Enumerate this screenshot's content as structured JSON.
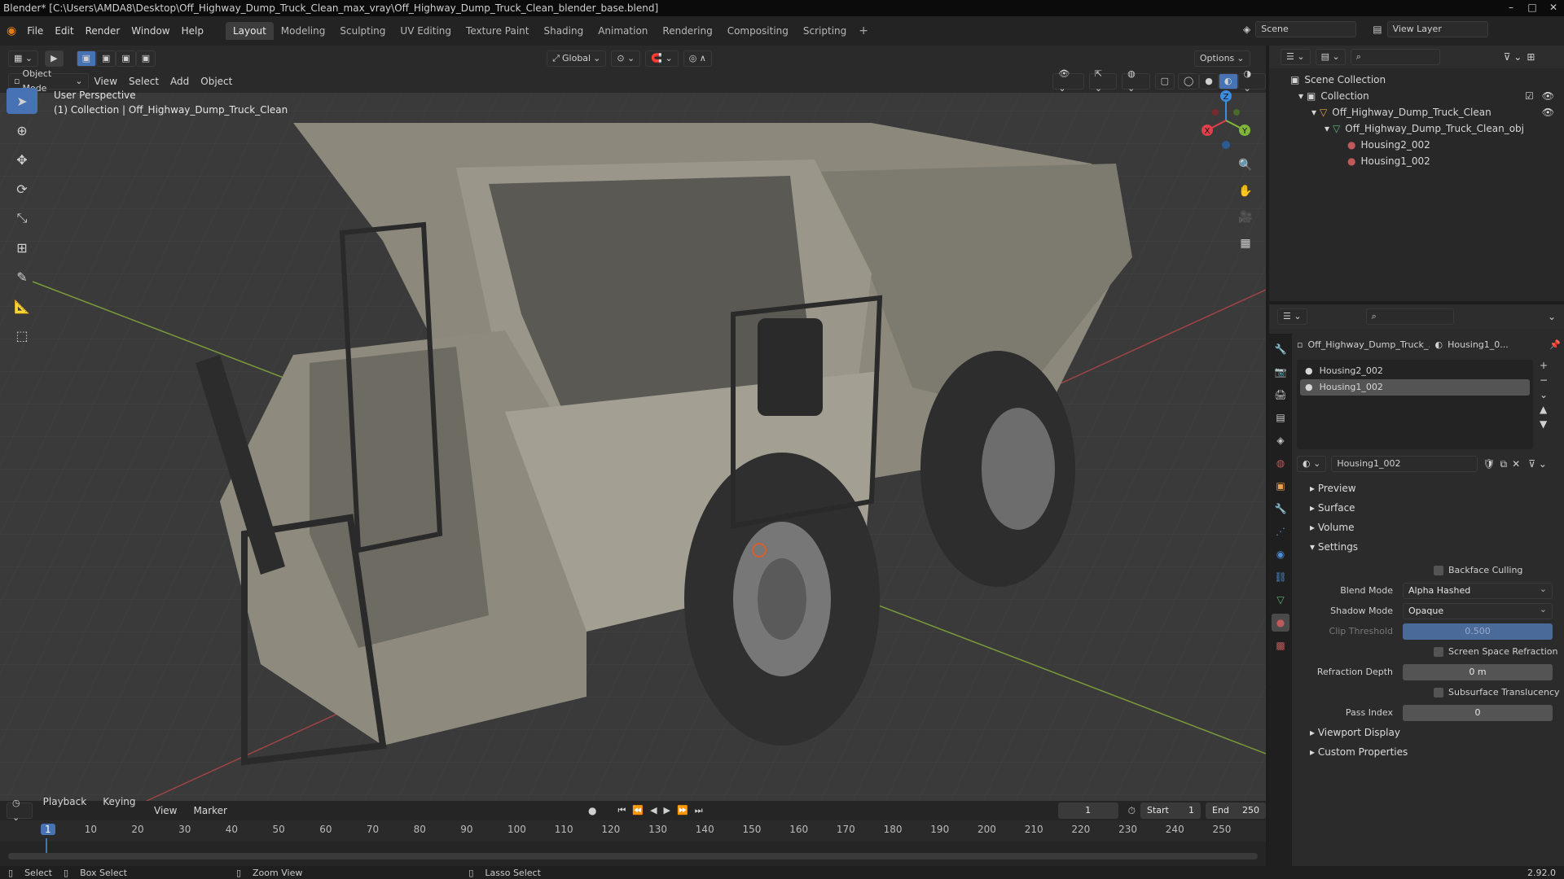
{
  "window": {
    "title": "Blender* [C:\\Users\\AMDA8\\Desktop\\Off_Highway_Dump_Truck_Clean_max_vray\\Off_Highway_Dump_Truck_Clean_blender_base.blend]"
  },
  "menu": [
    "File",
    "Edit",
    "Render",
    "Window",
    "Help"
  ],
  "workspaces": [
    "Layout",
    "Modeling",
    "Sculpting",
    "UV Editing",
    "Texture Paint",
    "Shading",
    "Animation",
    "Rendering",
    "Compositing",
    "Scripting"
  ],
  "active_workspace": "Layout",
  "scene": {
    "label": "Scene",
    "view_layer": "View Layer"
  },
  "viewport": {
    "transform_orientation": "Global",
    "options_label": "Options",
    "mode": "Object Mode",
    "menus": [
      "View",
      "Select",
      "Add",
      "Object"
    ],
    "info_line1": "User Perspective",
    "info_line2": "(1) Collection | Off_Highway_Dump_Truck_Clean",
    "gizmo_axes": {
      "x": "X",
      "y": "Y",
      "z": "Z"
    }
  },
  "outliner": {
    "items": [
      {
        "label": "Scene Collection",
        "level": 0
      },
      {
        "label": "Collection",
        "level": 1
      },
      {
        "label": "Off_Highway_Dump_Truck_Clean",
        "level": 2
      },
      {
        "label": "Off_Highway_Dump_Truck_Clean_obj",
        "level": 3
      },
      {
        "label": "Housing2_002",
        "level": 4
      },
      {
        "label": "Housing1_002",
        "level": 4
      }
    ]
  },
  "properties": {
    "object_name": "Off_Highway_Dump_Truck_...",
    "material_name_short": "Housing1_0...",
    "slots": [
      "Housing2_002",
      "Housing1_002"
    ],
    "selected_slot": "Housing1_002",
    "material": "Housing1_002",
    "panels": {
      "preview": "Preview",
      "surface": "Surface",
      "volume": "Volume",
      "settings": "Settings",
      "viewport_display": "Viewport Display",
      "custom_properties": "Custom Properties"
    },
    "settings": {
      "backface_culling": "Backface Culling",
      "blend_mode_label": "Blend Mode",
      "blend_mode": "Alpha Hashed",
      "shadow_mode_label": "Shadow Mode",
      "shadow_mode": "Opaque",
      "clip_threshold_label": "Clip Threshold",
      "clip_threshold": "0.500",
      "ssr_label": "Screen Space Refraction",
      "refraction_depth_label": "Refraction Depth",
      "refraction_depth": "0 m",
      "subsurface_label": "Subsurface Translucency",
      "pass_index_label": "Pass Index",
      "pass_index": "0"
    }
  },
  "timeline": {
    "menus": [
      "Playback",
      "Keying",
      "View",
      "Marker"
    ],
    "current_frame": "1",
    "start_label": "Start",
    "start": "1",
    "end_label": "End",
    "end": "250",
    "ticks": [
      "1",
      "10",
      "20",
      "30",
      "40",
      "50",
      "60",
      "70",
      "80",
      "90",
      "100",
      "110",
      "120",
      "130",
      "140",
      "150",
      "160",
      "170",
      "180",
      "190",
      "200",
      "210",
      "220",
      "230",
      "240",
      "250"
    ]
  },
  "statusbar": {
    "select": "Select",
    "box_select": "Box Select",
    "zoom_view": "Zoom View",
    "lasso_select": "Lasso Select",
    "version": "2.92.0"
  },
  "colors": {
    "accent": "#4772b3",
    "axis_x": "#e0404a",
    "axis_y": "#7fb53a",
    "axis_z": "#3b8de0"
  }
}
